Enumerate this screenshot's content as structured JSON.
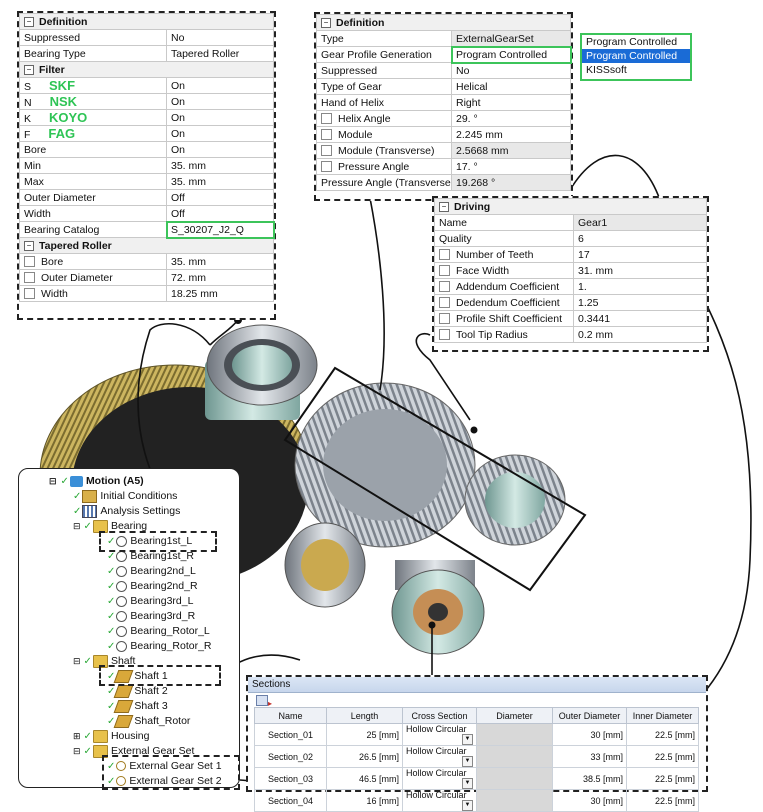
{
  "bearing_panel": {
    "definition": {
      "header": "Definition",
      "rows": [
        {
          "label": "Suppressed",
          "value": "No"
        },
        {
          "label": "Bearing Type",
          "value": "Tapered Roller"
        }
      ]
    },
    "filter": {
      "header": "Filter",
      "brand_rows": [
        {
          "label": "S",
          "brand": "SKF",
          "value": "On"
        },
        {
          "label": "N",
          "brand": "NSK",
          "value": "On"
        },
        {
          "label": "K",
          "brand": "KOYO",
          "value": "On"
        },
        {
          "label": "F",
          "brand": "FAG",
          "value": "On"
        }
      ],
      "rows": [
        {
          "label": "Bore",
          "value": "On"
        },
        {
          "label": "Min",
          "value": "35. mm"
        },
        {
          "label": "Max",
          "value": "35. mm"
        },
        {
          "label": "Outer Diameter",
          "value": "Off"
        },
        {
          "label": "Width",
          "value": "Off"
        },
        {
          "label": "Bearing Catalog",
          "value": "S_30207_J2_Q"
        }
      ]
    },
    "tapered_roller": {
      "header": "Tapered Roller",
      "rows": [
        {
          "label": "Bore",
          "value": "35. mm"
        },
        {
          "label": "Outer Diameter",
          "value": "72. mm"
        },
        {
          "label": "Width",
          "value": "18.25 mm"
        }
      ]
    }
  },
  "gear_panel": {
    "header": "Definition",
    "rows": [
      {
        "label": "Type",
        "value": "ExternalGearSet"
      },
      {
        "label": "Gear Profile Generation",
        "value": "Program Controlled"
      },
      {
        "label": "Suppressed",
        "value": "No"
      },
      {
        "label": "Type of Gear",
        "value": "Helical"
      },
      {
        "label": "Hand of Helix",
        "value": "Right"
      },
      {
        "label": "Helix Angle",
        "value": "29. °"
      },
      {
        "label": "Module",
        "value": "2.245 mm"
      },
      {
        "label": "Module (Transverse)",
        "value": "2.5668 mm"
      },
      {
        "label": "Pressure Angle",
        "value": "17. °"
      },
      {
        "label": "Pressure Angle (Transverse)",
        "value": "19.268 °"
      }
    ]
  },
  "profile_dropdown": {
    "current": "Program Controlled",
    "options": [
      "Program Controlled",
      "KISSsoft"
    ],
    "highlighted": "Program Controlled"
  },
  "driving_panel": {
    "header": "Driving",
    "rows": [
      {
        "label": "Name",
        "value": "Gear1"
      },
      {
        "label": "Quality",
        "value": "6"
      },
      {
        "label": "Number of Teeth",
        "value": "17"
      },
      {
        "label": "Face Width",
        "value": "31. mm"
      },
      {
        "label": "Addendum Coefficient",
        "value": "1."
      },
      {
        "label": "Dedendum Coefficient",
        "value": "1.25"
      },
      {
        "label": "Profile Shift Coefficient",
        "value": "0.3441"
      },
      {
        "label": "Tool Tip Radius",
        "value": "0.2 mm"
      }
    ]
  },
  "tree": {
    "root": "Motion (A5)",
    "items": [
      {
        "label": "Initial Conditions",
        "icon": "initial-conditions-icon"
      },
      {
        "label": "Analysis Settings",
        "icon": "analysis-settings-icon"
      },
      {
        "label": "Bearing",
        "icon": "folder-icon"
      },
      {
        "label": "Bearing1st_L",
        "icon": "bearing-icon"
      },
      {
        "label": "Bearing1st_R",
        "icon": "bearing-icon"
      },
      {
        "label": "Bearing2nd_L",
        "icon": "bearing-icon"
      },
      {
        "label": "Bearing2nd_R",
        "icon": "bearing-icon"
      },
      {
        "label": "Bearing3rd_L",
        "icon": "bearing-icon"
      },
      {
        "label": "Bearing3rd_R",
        "icon": "bearing-icon"
      },
      {
        "label": "Bearing_Rotor_L",
        "icon": "bearing-icon"
      },
      {
        "label": "Bearing_Rotor_R",
        "icon": "bearing-icon"
      },
      {
        "label": "Shaft",
        "icon": "folder-icon"
      },
      {
        "label": "Shaft 1",
        "icon": "shaft-icon"
      },
      {
        "label": "Shaft 2",
        "icon": "shaft-icon"
      },
      {
        "label": "Shaft 3",
        "icon": "shaft-icon"
      },
      {
        "label": "Shaft_Rotor",
        "icon": "shaft-icon"
      },
      {
        "label": "Housing",
        "icon": "folder-icon"
      },
      {
        "label": "External Gear Set",
        "icon": "folder-icon"
      },
      {
        "label": "External Gear Set 1",
        "icon": "gear-set-icon"
      },
      {
        "label": "External Gear Set 2",
        "icon": "gear-set-icon"
      }
    ]
  },
  "sections": {
    "title": "Sections",
    "headers": [
      "Name",
      "Length",
      "Cross Section",
      "Diameter",
      "Outer Diameter",
      "Inner Diameter"
    ],
    "rows": [
      [
        "Section_01",
        "25 [mm]",
        "Hollow Circular",
        "",
        "30 [mm]",
        "22.5 [mm]"
      ],
      [
        "Section_02",
        "26.5 [mm]",
        "Hollow Circular",
        "",
        "33 [mm]",
        "22.5 [mm]"
      ],
      [
        "Section_03",
        "46.5 [mm]",
        "Hollow Circular",
        "",
        "38.5 [mm]",
        "22.5 [mm]"
      ],
      [
        "Section_04",
        "16 [mm]",
        "Hollow Circular",
        "",
        "30 [mm]",
        "22.5 [mm]"
      ]
    ]
  },
  "colors": {
    "highlight": "#3cc45a",
    "brand_text": "#2ec455",
    "dropdown_selected": "#1a6bd6",
    "gear_gold": "#c9b25a",
    "gear_steel": "#b9bec6",
    "bearing_teal": "#b7d3cf"
  }
}
